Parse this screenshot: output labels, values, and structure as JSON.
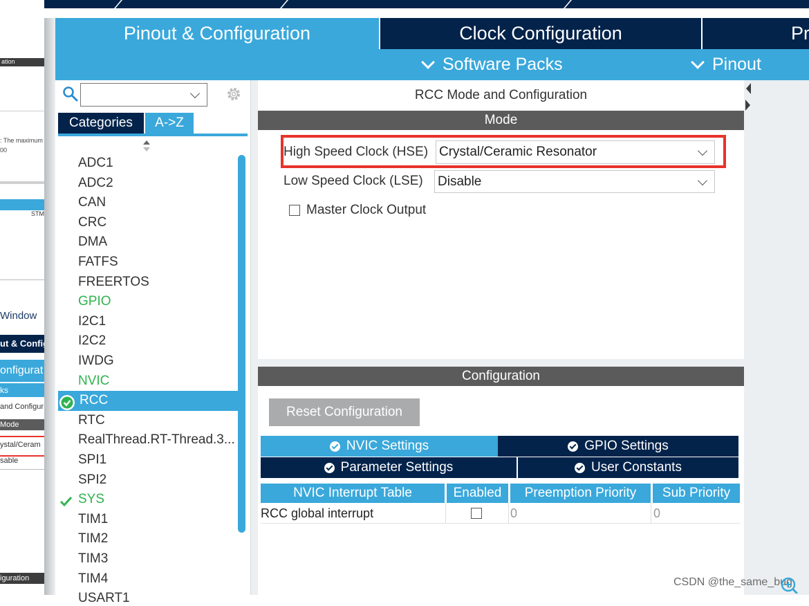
{
  "background_window": {
    "lines": [
      "ation",
      ": The maximum",
      "00",
      "STM",
      "Window",
      "ut & Config",
      "onfigurat",
      "ks",
      "and Configur",
      "Mode",
      "ystal/Ceram",
      "sable",
      "iguration"
    ]
  },
  "main_tabs": [
    {
      "label": "Pinout & Configuration"
    },
    {
      "label": "Clock Configuration"
    },
    {
      "label": "Pr"
    }
  ],
  "sub_nav": {
    "software_packs": "Software Packs",
    "pinout": "Pinout"
  },
  "left_panel": {
    "search_value": "",
    "tabs": {
      "categories": "Categories",
      "az": "A->Z"
    },
    "items": [
      {
        "label": "ADC1",
        "status": ""
      },
      {
        "label": "ADC2",
        "status": ""
      },
      {
        "label": "CAN",
        "status": ""
      },
      {
        "label": "CRC",
        "status": ""
      },
      {
        "label": "DMA",
        "status": ""
      },
      {
        "label": "FATFS",
        "status": ""
      },
      {
        "label": "FREERTOS",
        "status": ""
      },
      {
        "label": "GPIO",
        "status": "green"
      },
      {
        "label": "I2C1",
        "status": ""
      },
      {
        "label": "I2C2",
        "status": ""
      },
      {
        "label": "IWDG",
        "status": ""
      },
      {
        "label": "NVIC",
        "status": "green"
      },
      {
        "label": "RCC",
        "status": "selected"
      },
      {
        "label": "RTC",
        "status": ""
      },
      {
        "label": "RealThread.RT-Thread.3...",
        "status": ""
      },
      {
        "label": "SPI1",
        "status": ""
      },
      {
        "label": "SPI2",
        "status": ""
      },
      {
        "label": "SYS",
        "status": "checked"
      },
      {
        "label": "TIM1",
        "status": ""
      },
      {
        "label": "TIM2",
        "status": ""
      },
      {
        "label": "TIM3",
        "status": ""
      },
      {
        "label": "TIM4",
        "status": ""
      },
      {
        "label": "USART1",
        "status": ""
      }
    ]
  },
  "mode_panel": {
    "title": "RCC Mode and Configuration",
    "header": "Mode",
    "hse_label": "High Speed Clock (HSE)",
    "hse_value": "Crystal/Ceramic Resonator",
    "lse_label": "Low Speed Clock (LSE)",
    "lse_value": "Disable",
    "mco_label": "Master Clock Output"
  },
  "config_panel": {
    "header": "Configuration",
    "reset_button": "Reset Configuration",
    "tabs": [
      {
        "label": "NVIC Settings"
      },
      {
        "label": "GPIO Settings"
      },
      {
        "label": "Parameter Settings"
      },
      {
        "label": "User Constants"
      }
    ],
    "table": {
      "columns": [
        "NVIC Interrupt Table",
        "Enabled",
        "Preemption Priority",
        "Sub Priority"
      ],
      "rows": [
        {
          "name": "RCC global interrupt",
          "enabled": false,
          "preemption": "0",
          "sub": "0"
        }
      ]
    }
  },
  "watermark": "CSDN @the_same_bug",
  "colors": {
    "navy": "#03234b",
    "accent_blue": "#3aa8db",
    "highlight_red": "#e8332a",
    "ok_green": "#2fb34f"
  }
}
